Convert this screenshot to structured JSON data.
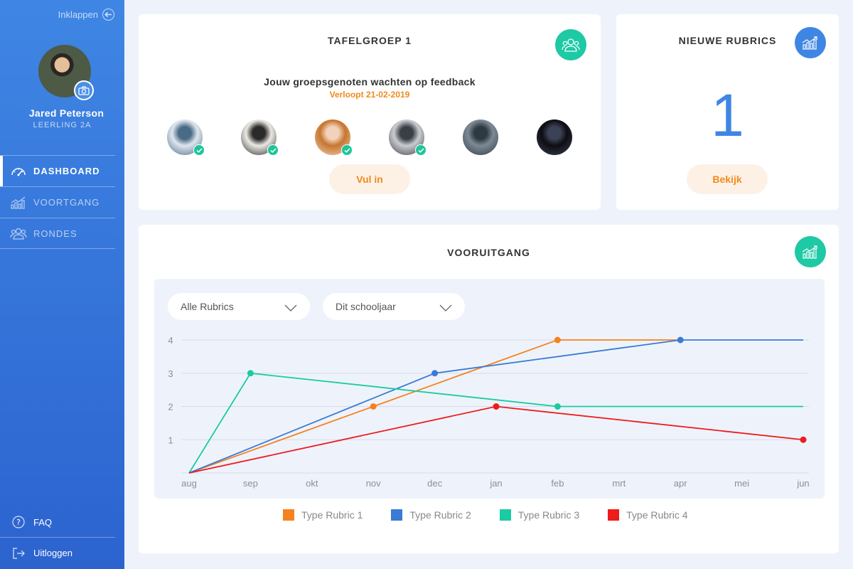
{
  "sidebar": {
    "collapse_label": "Inklappen",
    "user_name": "Jared Peterson",
    "user_class": "LEERLING 2A",
    "nav": [
      {
        "label": "DASHBOARD",
        "icon": "gauge-icon"
      },
      {
        "label": "VOORTGANG",
        "icon": "bar-chart-icon"
      },
      {
        "label": "RONDES",
        "icon": "group-icon"
      }
    ],
    "bottom": [
      {
        "label": "FAQ",
        "icon": "question-icon"
      },
      {
        "label": "Uitloggen",
        "icon": "logout-icon"
      }
    ]
  },
  "group_card": {
    "title": "TAFELGROEP 1",
    "message": "Jouw groepsgenoten wachten op feedback",
    "deadline": "Verloopt 21-02-2019",
    "button": "Vul in",
    "members": [
      {
        "checked": true,
        "palette": [
          "#dfe6ee",
          "#4a6b86"
        ]
      },
      {
        "checked": true,
        "palette": [
          "#ece9e4",
          "#2a2a2a"
        ]
      },
      {
        "checked": true,
        "palette": [
          "#c7762e",
          "#f2d2bb"
        ]
      },
      {
        "checked": true,
        "palette": [
          "#c9ccd0",
          "#3a3f46"
        ]
      },
      {
        "checked": false,
        "palette": [
          "#7d8a96",
          "#2f3940"
        ]
      },
      {
        "checked": false,
        "palette": [
          "#0d0d12",
          "#3b4256"
        ]
      }
    ]
  },
  "rubrics_card": {
    "title": "NIEUWE RUBRICS",
    "count": "1",
    "button": "Bekijk"
  },
  "progress": {
    "title": "VOORUITGANG",
    "filter_rubrics": "Alle Rubrics",
    "filter_period": "Dit schooljaar"
  },
  "colors": {
    "accent_blue": "#3f86e4",
    "accent_teal": "#1ec9a5",
    "accent_orange": "#f08a1c"
  },
  "chart_data": {
    "type": "line",
    "x": [
      "aug",
      "sep",
      "okt",
      "nov",
      "dec",
      "jan",
      "feb",
      "mrt",
      "apr",
      "mei",
      "jun"
    ],
    "ylim": [
      0,
      4
    ],
    "yticks": [
      1,
      2,
      3,
      4
    ],
    "grid": true,
    "legend_position": "bottom",
    "series": [
      {
        "name": "Type Rubric 1",
        "color": "#f6821f",
        "points": [
          [
            0,
            0
          ],
          [
            3,
            2
          ],
          [
            6,
            4
          ],
          [
            8,
            4
          ]
        ],
        "markers": [
          3,
          6
        ]
      },
      {
        "name": "Type Rubric 2",
        "color": "#3a7bd5",
        "points": [
          [
            0,
            0
          ],
          [
            4,
            3
          ],
          [
            8,
            4
          ],
          [
            10,
            4
          ]
        ],
        "markers": [
          4,
          8
        ]
      },
      {
        "name": "Type Rubric 3",
        "color": "#1bcba2",
        "points": [
          [
            0,
            0
          ],
          [
            1,
            3
          ],
          [
            6,
            2
          ],
          [
            10,
            2
          ]
        ],
        "markers": [
          1,
          6
        ]
      },
      {
        "name": "Type Rubric 4",
        "color": "#ee1b1b",
        "points": [
          [
            0,
            0
          ],
          [
            5,
            2
          ],
          [
            10,
            1
          ]
        ],
        "markers": [
          5,
          10
        ]
      }
    ]
  }
}
